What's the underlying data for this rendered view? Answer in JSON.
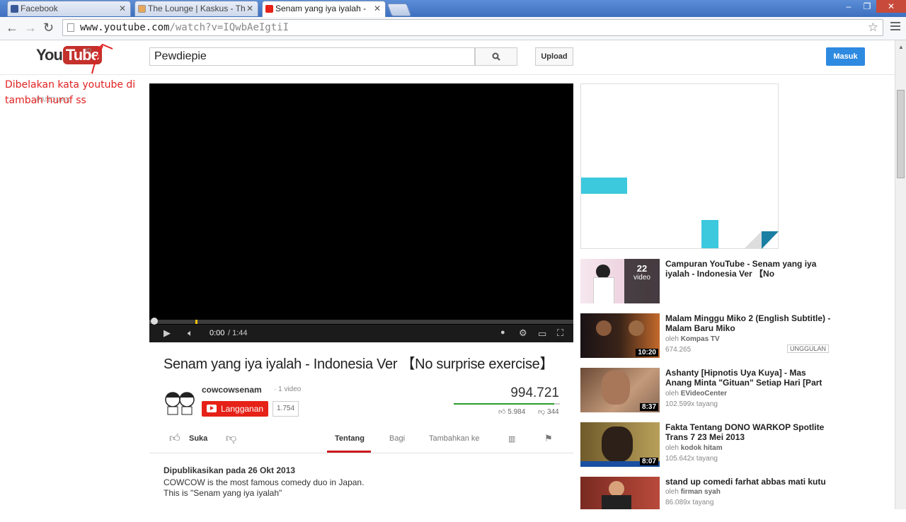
{
  "browser": {
    "tabs": [
      {
        "label": "Facebook",
        "active": false
      },
      {
        "label": "The Lounge | Kaskus - Th",
        "active": false
      },
      {
        "label": "Senam yang iya iyalah  -",
        "active": true
      }
    ],
    "url_domain": "www.youtube.com",
    "url_path": "/watch?v=IQwbAeIgtiI"
  },
  "header": {
    "logo_text": "You",
    "logo_tube": "Tube",
    "country": "ID",
    "search_value": "Pewdiepie",
    "upload_label": "Upload",
    "signin_label": "Masuk"
  },
  "annotation": {
    "text": "Dibelakan kata youtube di tambah huruf ss",
    "ghost": "PANDUAN"
  },
  "player": {
    "time_current": "0:00",
    "time_total": "/ 1:44",
    "progress": 0.0
  },
  "video": {
    "title": "Senam yang iya iyalah  -  Indonesia  Ver  【No surprise exercise】",
    "channel": "cowcowsenam",
    "video_count": "· 1 video",
    "subscribe_label": "Langganan",
    "subscriber_count": "1.754",
    "views": "994.721",
    "likes": "5.984",
    "dislikes": "344",
    "like_ratio": 0.946,
    "actions": {
      "like": "Suka",
      "about": "Tentang",
      "share": "Bagi",
      "add_to": "Tambahkan ke"
    },
    "published": "Dipublikasikan pada 26 Okt 2013",
    "description_1": "COWCOW  is  the  most  famous comedy duo in Japan.",
    "description_2": "This is \"Senam yang iya iyalah\""
  },
  "related": [
    {
      "title": "Campuran YouTube - Senam yang iya iyalah  -  Indonesia  Ver  【No",
      "playlist_count": "22",
      "playlist_label": "video"
    },
    {
      "title": "Malam Minggu Miko 2 (English Subtitle) - Malam Baru Miko",
      "by_prefix": "oleh",
      "channel": "Kompas TV",
      "views": "674.265",
      "duration": "10:20",
      "badge": "UNGGULAN"
    },
    {
      "title": "Ashanty [Hipnotis Uya Kuya] - Mas Anang Minta \"Gituan\" Setiap Hari [Part",
      "by_prefix": "oleh",
      "channel": "EVideoCenter",
      "views": "102.599x tayang",
      "duration": "8:37"
    },
    {
      "title": "Fakta Tentang DONO WARKOP Spotlite Trans 7 23 Mei 2013",
      "by_prefix": "oleh",
      "channel": "kodok hitam",
      "views": "105.642x tayang",
      "duration": "8:07"
    },
    {
      "title": "stand up comedi farhat abbas mati kutu",
      "by_prefix": "oleh",
      "channel": "firman syah",
      "views": "86.089x tayang"
    }
  ],
  "colors": {
    "accent_red": "#e62117",
    "signin_blue": "#2d8ae0",
    "annotation_red": "#e02222",
    "view_bar_green": "#2b9c2b"
  }
}
